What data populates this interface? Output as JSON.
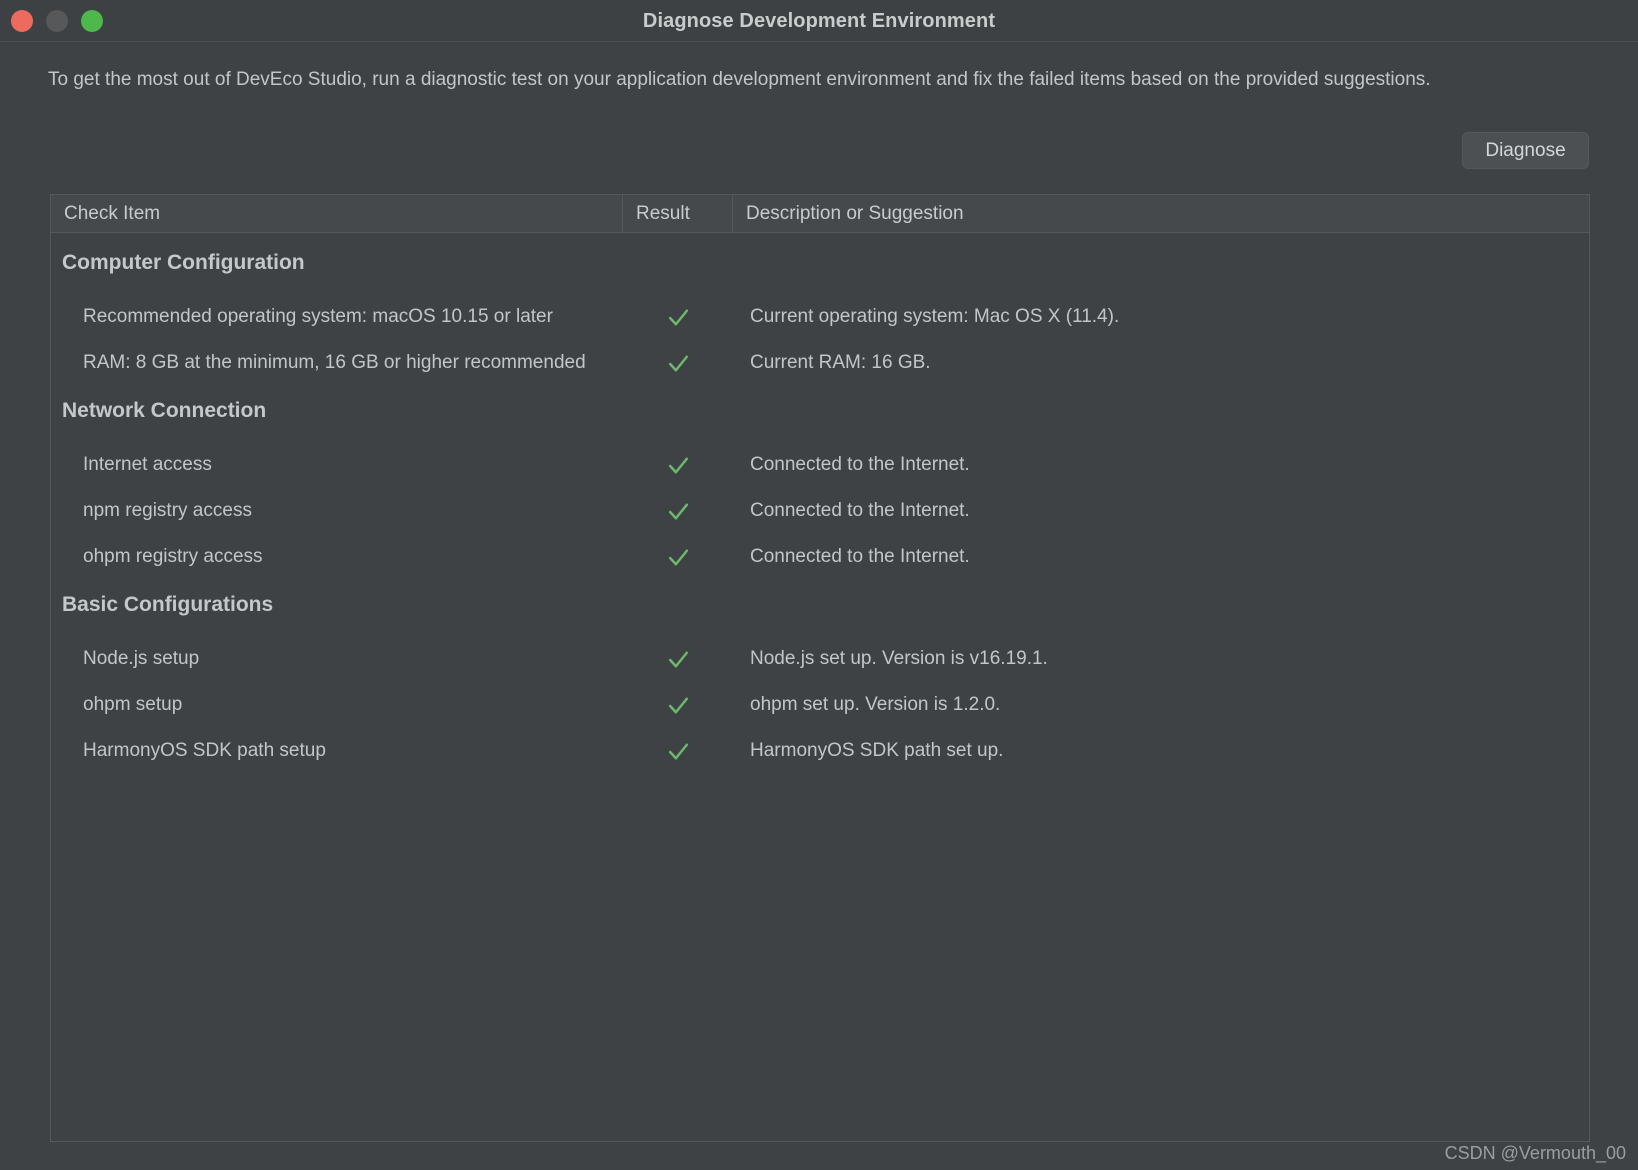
{
  "window": {
    "title": "Diagnose Development Environment",
    "traffic_lights": [
      {
        "name": "close",
        "color": "#ed6a5e"
      },
      {
        "name": "minimize",
        "color": "#56585a"
      },
      {
        "name": "zoom",
        "color": "#4fb84c"
      }
    ]
  },
  "intro": "To get the most out of DevEco Studio, run a diagnostic test on your application development environment and fix the failed items based on the provided suggestions.",
  "actions": {
    "diagnose_label": "Diagnose"
  },
  "table": {
    "columns": [
      "Check Item",
      "Result",
      "Description or Suggestion"
    ],
    "sections": [
      {
        "title": "Computer Configuration",
        "rows": [
          {
            "item": "Recommended operating system: macOS 10.15 or later",
            "result": "pass",
            "result_icon": "check-icon",
            "description": "Current operating system: Mac OS X (11.4)."
          },
          {
            "item": "RAM: 8 GB at the minimum, 16 GB or higher recommended",
            "result": "pass",
            "result_icon": "check-icon",
            "description": "Current RAM: 16 GB."
          }
        ]
      },
      {
        "title": "Network Connection",
        "rows": [
          {
            "item": "Internet access",
            "result": "pass",
            "result_icon": "check-icon",
            "description": "Connected to the Internet."
          },
          {
            "item": "npm registry access",
            "result": "pass",
            "result_icon": "check-icon",
            "description": "Connected to the Internet."
          },
          {
            "item": "ohpm registry access",
            "result": "pass",
            "result_icon": "check-icon",
            "description": "Connected to the Internet."
          }
        ]
      },
      {
        "title": "Basic Configurations",
        "rows": [
          {
            "item": "Node.js setup",
            "result": "pass",
            "result_icon": "check-icon",
            "description": "Node.js set up. Version is v16.19.1."
          },
          {
            "item": "ohpm setup",
            "result": "pass",
            "result_icon": "check-icon",
            "description": "ohpm set up. Version is 1.2.0."
          },
          {
            "item": "HarmonyOS SDK path setup",
            "result": "pass",
            "result_icon": "check-icon",
            "description": "HarmonyOS SDK path set up."
          }
        ]
      }
    ]
  },
  "watermark": "CSDN @Vermouth_00",
  "colors": {
    "pass_check": "#6cb86c",
    "background": "#3f4244",
    "header_background": "#46494b",
    "border": "#54585a",
    "text": "#c2c6c8"
  }
}
